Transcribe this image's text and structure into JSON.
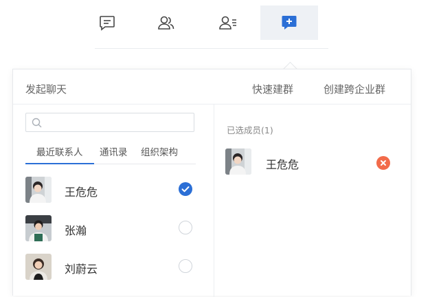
{
  "toolbar": {
    "buttons": [
      {
        "icon": "chat-message-icon"
      },
      {
        "icon": "contacts-icon"
      },
      {
        "icon": "address-book-icon"
      },
      {
        "icon": "new-chat-plus-icon"
      }
    ]
  },
  "panel": {
    "title": "发起聊天",
    "quick_group": "快速建群",
    "create_enterprise_group": "创建跨企业群",
    "search": {
      "value": "",
      "placeholder": ""
    },
    "tabs": [
      {
        "label": "最近联系人",
        "active": true
      },
      {
        "label": "通讯录",
        "active": false
      },
      {
        "label": "组织架构",
        "active": false
      }
    ],
    "contacts": [
      {
        "name": "王危危",
        "selected": true
      },
      {
        "name": "张瀚",
        "selected": false
      },
      {
        "name": "刘蔚云",
        "selected": false
      }
    ],
    "selected_label": "已选成员(1)",
    "selected": [
      {
        "name": "王危危"
      }
    ]
  },
  "colors": {
    "accent": "#2b6fd6",
    "remove": "#f26b4a",
    "active_toolbar_bg": "#eef1f5"
  }
}
